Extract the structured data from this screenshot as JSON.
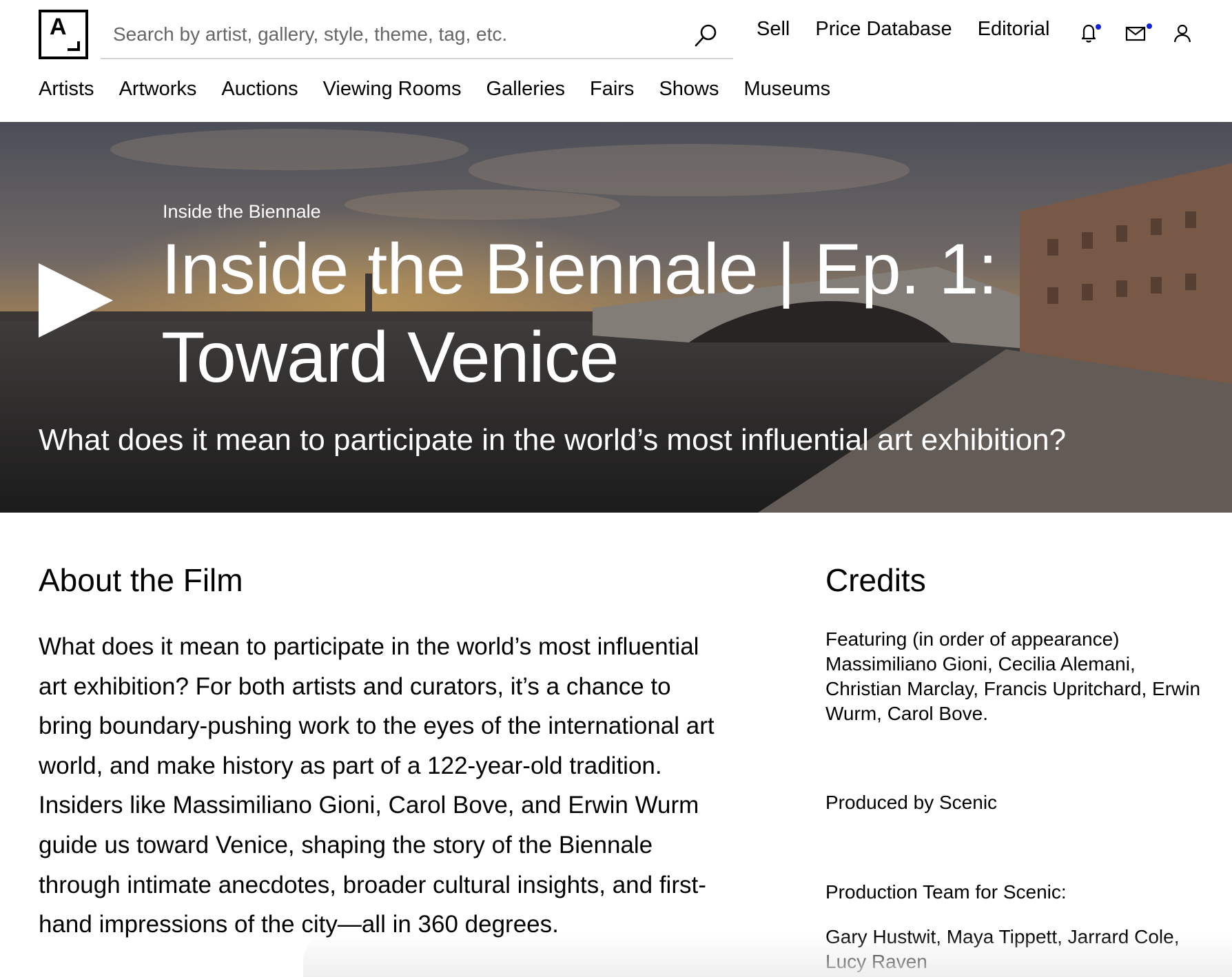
{
  "header": {
    "logo_letter": "A",
    "search_placeholder": "Search by artist, gallery, style, theme, tag, etc.",
    "links": [
      "Sell",
      "Price Database",
      "Editorial"
    ],
    "icons": [
      "bell-icon",
      "mail-icon",
      "user-icon"
    ],
    "notification_dot_color": "#1023d7"
  },
  "catnav": [
    "Artists",
    "Artworks",
    "Auctions",
    "Viewing Rooms",
    "Galleries",
    "Fairs",
    "Shows",
    "Museums"
  ],
  "hero": {
    "kicker": "Inside the Biennale",
    "title": "Inside the Biennale | Ep. 1: Toward Venice",
    "subtitle": "What does it mean to participate in the world’s most influential art exhibition?"
  },
  "about": {
    "heading": "About the Film",
    "body": "What does it mean to participate in the world’s most influential art exhibition? For both artists and curators, it’s a chance to bring boundary-pushing work to the eyes of the international art world, and make history as part of a 122-year-old tradition. Insiders like Massimiliano Gioni, Carol Bove, and Erwin Wurm guide us toward Venice, shaping the story of the Biennale through intimate anecdotes, broader cultural insights, and first-hand impressions of the city—all in 360 degrees."
  },
  "credits": {
    "heading": "Credits",
    "featuring": "Featuring (in order of appearance) Massimiliano Gioni, Cecilia Alemani, Christian Marclay, Francis Upritchard, Erwin Wurm, Carol Bove.",
    "produced_by": "Produced by Scenic",
    "team_label": "Production Team for Scenic:",
    "team": "Gary Hustwit, Maya Tippett, Jarrard Cole, Lucy Raven"
  }
}
